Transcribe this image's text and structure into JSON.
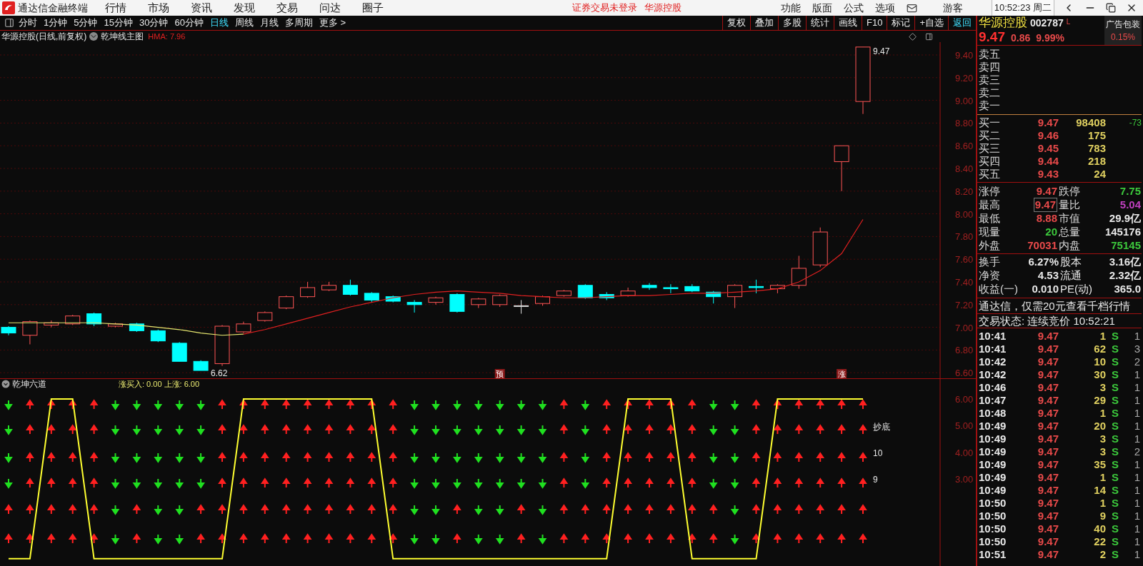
{
  "app": {
    "title": "通达信金融终端",
    "menu": [
      "行情",
      "市场",
      "资讯",
      "发现",
      "交易",
      "问达",
      "圈子"
    ],
    "notice": "证券交易未登录",
    "notice_stock": "华源控股",
    "right_menu": [
      "功能",
      "版面",
      "公式",
      "选项"
    ],
    "user": "游客",
    "clock": "10:52:23 周二"
  },
  "period_tabs": [
    {
      "label": "分时",
      "selected": false
    },
    {
      "label": "1分钟",
      "selected": false
    },
    {
      "label": "5分钟",
      "selected": false
    },
    {
      "label": "15分钟",
      "selected": false
    },
    {
      "label": "30分钟",
      "selected": false
    },
    {
      "label": "60分钟",
      "selected": false
    },
    {
      "label": "日线",
      "selected": true
    },
    {
      "label": "周线",
      "selected": false
    },
    {
      "label": "月线",
      "selected": false
    },
    {
      "label": "多周期",
      "selected": false
    },
    {
      "label": "更多 >",
      "selected": false
    }
  ],
  "tools": [
    {
      "label": "复权",
      "kind": "tool"
    },
    {
      "label": "叠加",
      "kind": "tool"
    },
    {
      "label": "多股",
      "kind": "tool"
    },
    {
      "label": "统计",
      "kind": "tool"
    },
    {
      "label": "画线",
      "kind": "tool"
    },
    {
      "label": "F10",
      "kind": "tool"
    },
    {
      "label": "标记",
      "kind": "tool"
    },
    {
      "label": "+自选",
      "kind": "tool"
    },
    {
      "label": "返回",
      "kind": "back"
    }
  ],
  "chart": {
    "title": "华源控股(日线,前复权)",
    "indicator": "乾坤线主图",
    "hma": "HMA: 7.96",
    "last_price": "9.47",
    "low_label": "6.62",
    "y_labels": [
      "9.40",
      "9.20",
      "9.00",
      "8.80",
      "8.60",
      "8.40",
      "8.20",
      "8.00",
      "7.80",
      "7.60",
      "7.40",
      "7.20",
      "7.00",
      "6.80",
      "6.60"
    ],
    "markers": [
      "预",
      "涨"
    ]
  },
  "sub_chart": {
    "title": "乾坤六道",
    "legend": "涨买入: 0.00 上涨: 6.00",
    "y_labels": [
      "6.00",
      "5.00",
      "4.00",
      "3.00"
    ],
    "notes": [
      "抄底",
      "10",
      "9"
    ]
  },
  "quote": {
    "name": "华源控股",
    "code": "002787",
    "flag": "L",
    "ad_title": "广告包装",
    "ad_value": "0.15%",
    "price": "9.47",
    "change": "0.86",
    "percent": "9.99%",
    "sell": [
      "卖五",
      "卖四",
      "卖三",
      "卖二",
      "卖一"
    ],
    "buy": [
      {
        "label": "买一",
        "price": "9.47",
        "volume": "98408",
        "extra": "-73"
      },
      {
        "label": "买二",
        "price": "9.46",
        "volume": "175"
      },
      {
        "label": "买三",
        "price": "9.45",
        "volume": "783"
      },
      {
        "label": "买四",
        "price": "9.44",
        "volume": "218"
      },
      {
        "label": "买五",
        "price": "9.43",
        "volume": "24"
      }
    ],
    "stats": [
      {
        "label": "涨停",
        "value": "9.47",
        "color": "#e84a4a",
        "boxed": false
      },
      {
        "label": "跌停",
        "value": "7.75",
        "color": "#3cc83c",
        "boxed": false
      },
      {
        "label": "最高",
        "value": "9.47",
        "color": "#e84a4a",
        "boxed": true
      },
      {
        "label": "量比",
        "value": "5.04",
        "color": "#c040c0",
        "boxed": false
      },
      {
        "label": "最低",
        "value": "8.88",
        "color": "#e84a4a",
        "boxed": false
      },
      {
        "label": "市值",
        "value": "29.9亿",
        "color": "#e8e8e8",
        "boxed": false
      },
      {
        "label": "现量",
        "value": "20",
        "color": "#3cc83c",
        "boxed": false
      },
      {
        "label": "总量",
        "value": "145176",
        "color": "#e8e8e8",
        "boxed": false
      },
      {
        "label": "外盘",
        "value": "70031",
        "color": "#e84a4a",
        "boxed": false
      },
      {
        "label": "内盘",
        "value": "75145",
        "color": "#3cc83c",
        "boxed": false
      }
    ],
    "finance": [
      {
        "label": "换手",
        "value": "6.27%",
        "label2": "股本",
        "value2": "3.16亿"
      },
      {
        "label": "净资",
        "value": "4.53",
        "label2": "流通",
        "value2": "2.32亿"
      },
      {
        "label": "收益(一)",
        "value": "0.010",
        "label2": "PE(动)",
        "value2": "365.0"
      }
    ],
    "banner": "通达信，仅需20元查看千档行情",
    "status": "交易状态: 连续竞价 10:52:21",
    "ticks": [
      {
        "time": "10:41",
        "price": "9.47",
        "volume": "1",
        "flag": "S",
        "count": "1"
      },
      {
        "time": "10:41",
        "price": "9.47",
        "volume": "62",
        "flag": "S",
        "count": "3"
      },
      {
        "time": "10:42",
        "price": "9.47",
        "volume": "10",
        "flag": "S",
        "count": "2"
      },
      {
        "time": "10:42",
        "price": "9.47",
        "volume": "30",
        "flag": "S",
        "count": "1"
      },
      {
        "time": "10:46",
        "price": "9.47",
        "volume": "3",
        "flag": "S",
        "count": "1"
      },
      {
        "time": "10:47",
        "price": "9.47",
        "volume": "29",
        "flag": "S",
        "count": "1"
      },
      {
        "time": "10:48",
        "price": "9.47",
        "volume": "1",
        "flag": "S",
        "count": "1"
      },
      {
        "time": "10:49",
        "price": "9.47",
        "volume": "20",
        "flag": "S",
        "count": "1"
      },
      {
        "time": "10:49",
        "price": "9.47",
        "volume": "3",
        "flag": "S",
        "count": "1"
      },
      {
        "time": "10:49",
        "price": "9.47",
        "volume": "3",
        "flag": "S",
        "count": "2"
      },
      {
        "time": "10:49",
        "price": "9.47",
        "volume": "35",
        "flag": "S",
        "count": "1"
      },
      {
        "time": "10:49",
        "price": "9.47",
        "volume": "1",
        "flag": "S",
        "count": "1"
      },
      {
        "time": "10:49",
        "price": "9.47",
        "volume": "14",
        "flag": "S",
        "count": "1"
      },
      {
        "time": "10:50",
        "price": "9.47",
        "volume": "1",
        "flag": "S",
        "count": "1"
      },
      {
        "time": "10:50",
        "price": "9.47",
        "volume": "9",
        "flag": "S",
        "count": "1"
      },
      {
        "time": "10:50",
        "price": "9.47",
        "volume": "40",
        "flag": "S",
        "count": "1"
      },
      {
        "time": "10:50",
        "price": "9.47",
        "volume": "22",
        "flag": "S",
        "count": "1"
      },
      {
        "time": "10:51",
        "price": "9.47",
        "volume": "2",
        "flag": "S",
        "count": "1"
      }
    ]
  }
}
